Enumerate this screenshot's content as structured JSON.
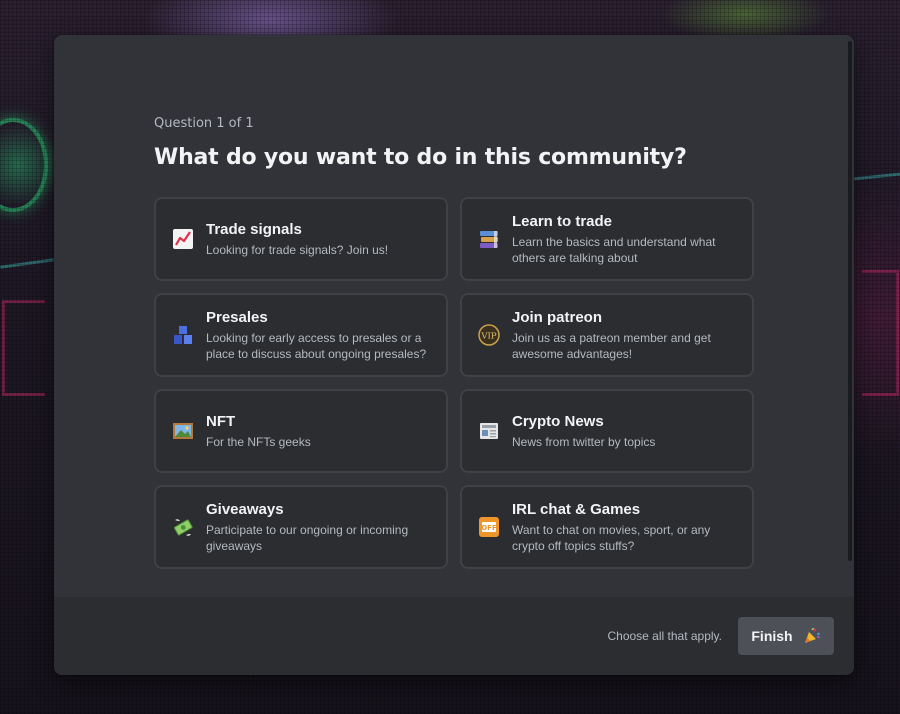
{
  "onboarding": {
    "counter": "Question 1 of 1",
    "title": "What do you want to do in this community?",
    "options": [
      {
        "title": "Trade signals",
        "description": "Looking for trade signals? Join us!",
        "emoji": "chart-increasing-icon"
      },
      {
        "title": "Learn to trade",
        "description": "Learn the basics and understand what others are talking about",
        "emoji": "books-icon"
      },
      {
        "title": "Presales",
        "description": "Looking for early access to presales or a place to discuss about ongoing presales?",
        "emoji": "blocks-icon"
      },
      {
        "title": "Join patreon",
        "description": "Join us as a patreon member and get awesome advantages!",
        "emoji": "vip-coin-icon"
      },
      {
        "title": "NFT",
        "description": "For the NFTs geeks",
        "emoji": "framed-picture-icon"
      },
      {
        "title": "Crypto News",
        "description": "News from twitter by topics",
        "emoji": "newspaper-icon"
      },
      {
        "title": "Giveaways",
        "description": "Participate to our ongoing or incoming giveaways",
        "emoji": "money-with-wings-icon"
      },
      {
        "title": "IRL chat & Games",
        "description": "Want to chat on movies, sport, or any crypto off topics stuffs?",
        "emoji": "off-sign-icon"
      }
    ]
  },
  "footer": {
    "hint": "Choose all that apply.",
    "finish_label": "Finish",
    "finish_icon": "party-popper-icon"
  },
  "colors": {
    "modal_bg": "#313338",
    "card_bg": "#2b2d31",
    "card_border": "#3f4147",
    "button_bg": "#4e5058",
    "text_primary": "#f2f3f5",
    "text_muted": "#b5bac1"
  }
}
